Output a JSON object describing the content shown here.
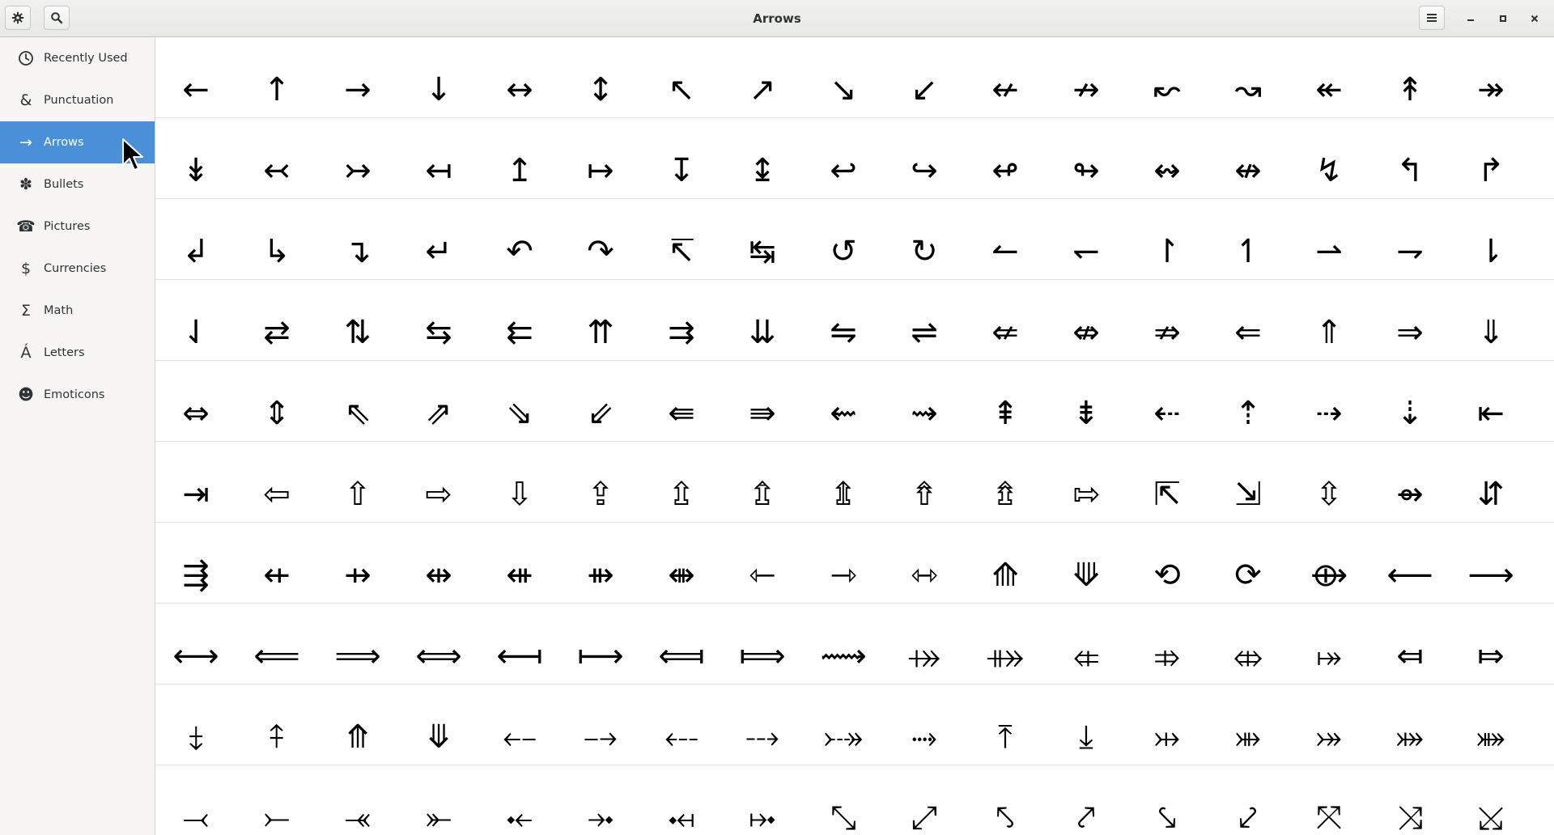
{
  "window": {
    "title": "Arrows"
  },
  "icons": {
    "settings": "gear-icon",
    "search": "search-icon",
    "menu": "hamburger-menu-icon",
    "minimize": "minimize-icon",
    "maximize": "maximize-icon",
    "close": "close-icon"
  },
  "colors": {
    "selected_bg": "#4a90d9",
    "sidebar_bg": "#f6f5f4",
    "header_bg": "#e8e8e7"
  },
  "sidebar": {
    "items": [
      {
        "label": "Recently Used",
        "icon": "clock-icon",
        "glyph": "🕓",
        "selected": false
      },
      {
        "label": "Punctuation",
        "icon": "ampersand-icon",
        "glyph": "&",
        "selected": false
      },
      {
        "label": "Arrows",
        "icon": "arrow-right-icon",
        "glyph": "→",
        "selected": true
      },
      {
        "label": "Bullets",
        "icon": "bullet-asterisk-icon",
        "glyph": "✽",
        "selected": false
      },
      {
        "label": "Pictures",
        "icon": "telephone-icon",
        "glyph": "☎",
        "selected": false
      },
      {
        "label": "Currencies",
        "icon": "dollar-icon",
        "glyph": "$",
        "selected": false
      },
      {
        "label": "Math",
        "icon": "sigma-icon",
        "glyph": "Σ",
        "selected": false
      },
      {
        "label": "Letters",
        "icon": "letter-a-acute-icon",
        "glyph": "Á",
        "selected": false
      },
      {
        "label": "Emoticons",
        "icon": "smiley-icon",
        "glyph": "☻",
        "selected": false
      }
    ]
  },
  "grid": {
    "rows": [
      [
        "←",
        "↑",
        "→",
        "↓",
        "↔",
        "↕",
        "↖",
        "↗",
        "↘",
        "↙",
        "↚",
        "↛",
        "↜",
        "↝",
        "↞",
        "↟",
        "↠"
      ],
      [
        "↡",
        "↢",
        "↣",
        "↤",
        "↥",
        "↦",
        "↧",
        "↨",
        "↩",
        "↪",
        "↫",
        "↬",
        "↭",
        "↮",
        "↯",
        "↰",
        "↱"
      ],
      [
        "↲",
        "↳",
        "↴",
        "↵",
        "↶",
        "↷",
        "↸",
        "↹",
        "↺",
        "↻",
        "↼",
        "↽",
        "↾",
        "↿",
        "⇀",
        "⇁",
        "⇂"
      ],
      [
        "⇃",
        "⇄",
        "⇅",
        "⇆",
        "⇇",
        "⇈",
        "⇉",
        "⇊",
        "⇋",
        "⇌",
        "⇍",
        "⇎",
        "⇏",
        "⇐",
        "⇑",
        "⇒",
        "⇓"
      ],
      [
        "⇔",
        "⇕",
        "⇖",
        "⇗",
        "⇘",
        "⇙",
        "⇚",
        "⇛",
        "⇜",
        "⇝",
        "⇞",
        "⇟",
        "⇠",
        "⇡",
        "⇢",
        "⇣",
        "⇤"
      ],
      [
        "⇥",
        "⇦",
        "⇧",
        "⇨",
        "⇩",
        "⇪",
        "⇫",
        "⇬",
        "⇭",
        "⇮",
        "⇯",
        "⇰",
        "⇱",
        "⇲",
        "⇳",
        "⇴",
        "⇵"
      ],
      [
        "⇶",
        "⇷",
        "⇸",
        "⇹",
        "⇺",
        "⇻",
        "⇼",
        "⇽",
        "⇾",
        "⇿",
        "⟰",
        "⟱",
        "⟲",
        "⟳",
        "⟴",
        "⟵",
        "⟶"
      ],
      [
        "⟷",
        "⟸",
        "⟹",
        "⟺",
        "⟻",
        "⟼",
        "⟽",
        "⟾",
        "⟿",
        "⤀",
        "⤁",
        "⤂",
        "⤃",
        "⤄",
        "⤅",
        "⤆",
        "⤇"
      ],
      [
        "⤈",
        "⤉",
        "⤊",
        "⤋",
        "⤌",
        "⤍",
        "⤎",
        "⤏",
        "⤐",
        "⤑",
        "⤒",
        "⤓",
        "⤔",
        "⤕",
        "⤖",
        "⤗",
        "⤘"
      ],
      [
        "⤙",
        "⤚",
        "⤛",
        "⤜",
        "⤝",
        "⤞",
        "⤟",
        "⤠",
        "⤡",
        "⤢",
        "⤣",
        "⤤",
        "⤥",
        "⤦",
        "⤧",
        "⤨",
        "⤩"
      ]
    ]
  }
}
